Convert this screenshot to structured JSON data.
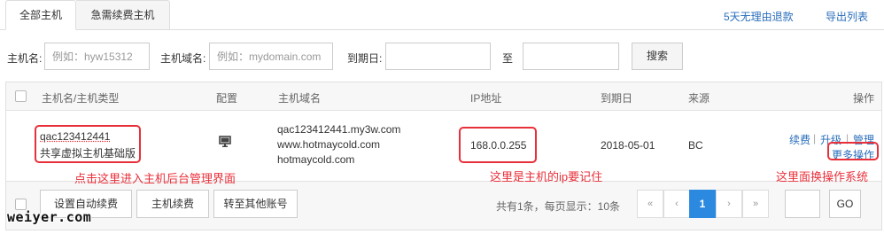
{
  "tabs": [
    "全部主机",
    "急需续费主机"
  ],
  "top_links": {
    "refund": "5天无理由退款",
    "export": "导出列表"
  },
  "filters": {
    "host_name_label": "主机名:",
    "host_name_placeholder": "例如：hyw15312",
    "domain_label": "主机域名:",
    "domain_placeholder": "例如：mydomain.com",
    "expiry_label": "到期日:",
    "to_label": "至",
    "search_label": "搜索"
  },
  "table": {
    "headers": [
      "主机名/主机类型",
      "配置",
      "主机域名",
      "IP地址",
      "到期日",
      "来源",
      "操作"
    ],
    "rows": [
      {
        "host_name": "qac123412441",
        "host_type": "共享虚拟主机基础版",
        "config_icon": "monitor-icon",
        "domains": [
          "qac123412441.my3w.com",
          "www.hotmaycold.com",
          "hotmaycold.com"
        ],
        "ip": "168.0.0.255",
        "expiry": "2018-05-01",
        "source": "BC",
        "actions": [
          "续费",
          "升级",
          "管理"
        ],
        "more": "更多操作"
      }
    ]
  },
  "footer": {
    "buttons": [
      "设置自动续费",
      "主机续费",
      "转至其他账号"
    ],
    "summary": "共有1条，每页显示：10条",
    "pages": [
      "«",
      "‹",
      "1",
      "›",
      "»"
    ],
    "go_label": "GO"
  },
  "annotations": {
    "note_host": "点击这里进入主机后台管理界面",
    "note_ip": "这里是主机的ip要记住",
    "note_ops": "这里面换操作系统"
  },
  "watermark": "weiyer.com",
  "colors": {
    "annotation": "#e8303a",
    "link": "#2a6ebb",
    "active_page": "#2b8ae0"
  }
}
